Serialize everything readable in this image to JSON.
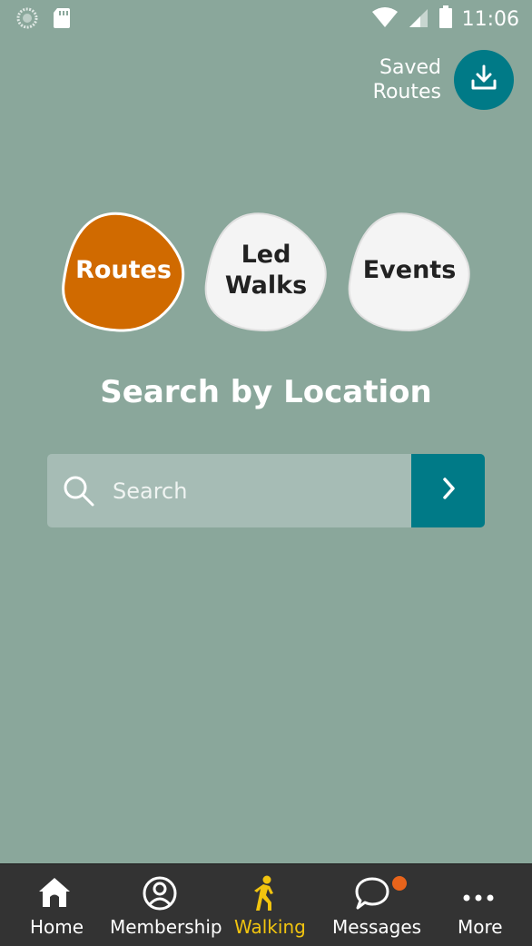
{
  "status_bar": {
    "time": "11:06",
    "icons": [
      "loading-icon",
      "sd-card-icon",
      "wifi-icon",
      "signal-icon",
      "battery-icon"
    ]
  },
  "saved_routes": {
    "label_line1": "Saved",
    "label_line2": "Routes",
    "icon": "download-icon"
  },
  "categories": [
    {
      "label_line1": "Routes",
      "label_line2": "",
      "selected": true,
      "color": "#d06a00"
    },
    {
      "label_line1": "Led",
      "label_line2": "Walks",
      "selected": false,
      "color": "#f4f4f4"
    },
    {
      "label_line1": "Events",
      "label_line2": "",
      "selected": false,
      "color": "#f4f4f4"
    }
  ],
  "heading": "Search by Location",
  "search": {
    "placeholder": "Search",
    "value": ""
  },
  "bottom_nav": {
    "items": [
      {
        "label": "Home",
        "icon": "home-icon"
      },
      {
        "label": "Membership",
        "icon": "membership-icon"
      },
      {
        "label": "Walking",
        "icon": "walking-icon",
        "active": true
      },
      {
        "label": "Messages",
        "icon": "messages-icon",
        "badge": true
      },
      {
        "label": "More",
        "icon": "more-icon"
      }
    ]
  },
  "colors": {
    "background": "#8aa79b",
    "accent_teal": "#007a87",
    "routes_orange": "#d06a00",
    "nav_active": "#f1c40f",
    "nav_bg": "#333333",
    "badge": "#e8641b"
  }
}
